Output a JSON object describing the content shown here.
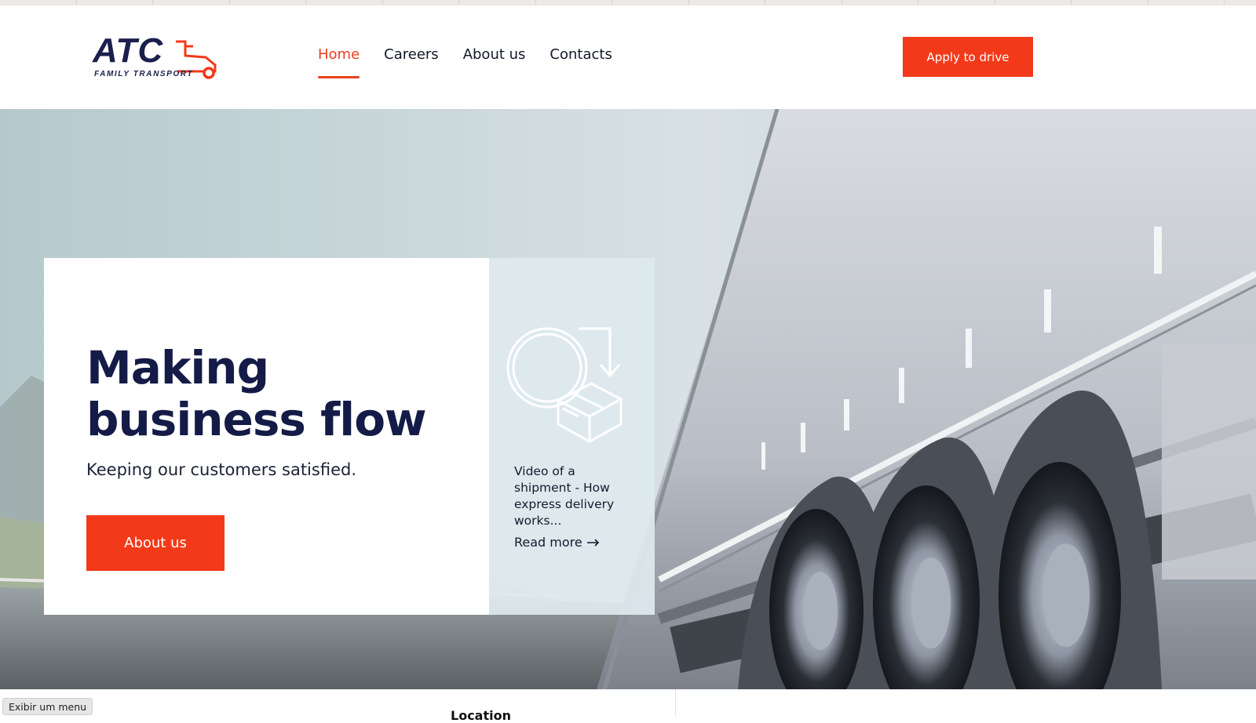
{
  "header": {
    "logo": {
      "mark": "ATC",
      "tagline": "FAMILY TRANSPORT"
    },
    "nav": [
      {
        "label": "Home",
        "active": true
      },
      {
        "label": "Careers",
        "active": false
      },
      {
        "label": "About us",
        "active": false
      },
      {
        "label": "Contacts",
        "active": false
      }
    ],
    "cta_label": "Apply to drive"
  },
  "hero": {
    "title": "Making\nbusiness flow",
    "subtitle": "Keeping our customers satisfied.",
    "button_label": "About us",
    "video": {
      "icon": "shipment-box-icon",
      "caption": "Video of a shipment - How express delivery works...",
      "link_label": "Read more",
      "link_icon": "arrow-right-icon"
    }
  },
  "section_below": {
    "heading": "Location"
  },
  "browser_overlay": {
    "show_menu_label": "Exibir um menu"
  },
  "colors": {
    "accent": "#f23a1a",
    "navy": "#141b47",
    "video_panel": "#dee9ee"
  }
}
